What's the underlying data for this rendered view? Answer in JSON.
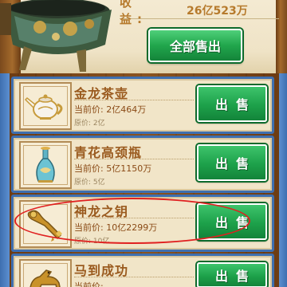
{
  "header": {
    "income_label": "收 益:",
    "income_value": "26亿523万",
    "sell_all_label": "全部售出"
  },
  "items": [
    {
      "name": "金龙茶壶",
      "current_price": "当前价: 2亿464万",
      "original_price": "原价:   2亿",
      "sell_label": "出售",
      "icon": "teapot-icon"
    },
    {
      "name": "青花高颈瓶",
      "current_price": "当前价: 5亿1150万",
      "original_price": "原价:   5亿",
      "sell_label": "出售",
      "icon": "vase-icon"
    },
    {
      "name": "神龙之钥",
      "current_price": "当前价: 10亿2299万",
      "original_price": "原价:   10亿",
      "sell_label": "出售",
      "icon": "dragon-key-icon"
    },
    {
      "name": "马到成功",
      "current_price": "当前价: ...",
      "original_price": "",
      "sell_label": "出售",
      "icon": "horse-statue-icon"
    }
  ],
  "colors": {
    "gold_text": "#b67a2c",
    "button_green": "#1da14a",
    "card_border": "#3e6fb0",
    "highlight": "#e02020"
  }
}
